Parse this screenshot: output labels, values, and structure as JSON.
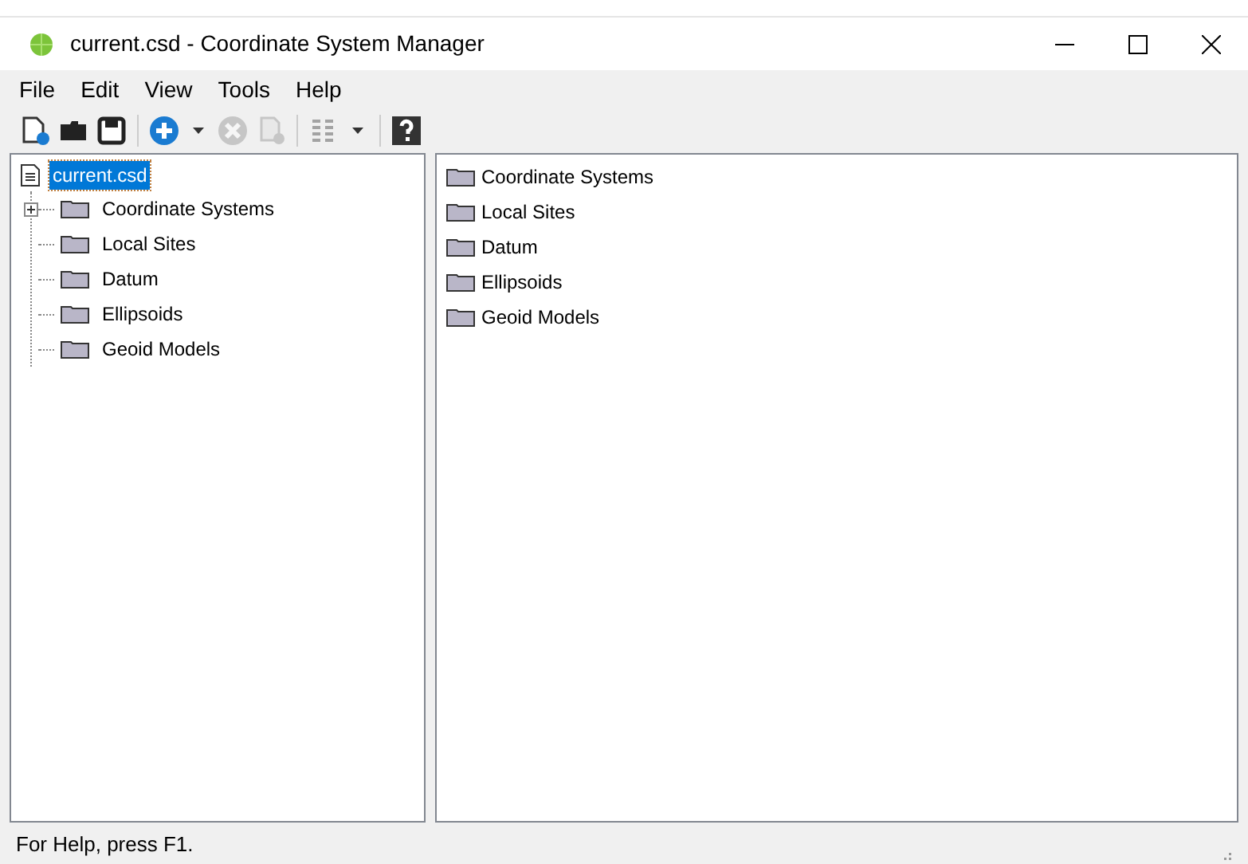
{
  "window": {
    "title": "current.csd - Coordinate System Manager"
  },
  "menu": [
    "File",
    "Edit",
    "View",
    "Tools",
    "Help"
  ],
  "toolbar": [
    {
      "kind": "new",
      "disabled": false
    },
    {
      "kind": "open",
      "disabled": false
    },
    {
      "kind": "save",
      "disabled": false
    },
    {
      "kind": "separator"
    },
    {
      "kind": "add",
      "disabled": false
    },
    {
      "kind": "dropdown",
      "disabled": false
    },
    {
      "kind": "delete",
      "disabled": true
    },
    {
      "kind": "copy",
      "disabled": true
    },
    {
      "kind": "separator"
    },
    {
      "kind": "columns",
      "disabled": true
    },
    {
      "kind": "dropdown",
      "disabled": false
    },
    {
      "kind": "separator"
    },
    {
      "kind": "help",
      "disabled": false
    }
  ],
  "tree": {
    "label": "current.csd",
    "selected": true,
    "children": [
      {
        "label": "Coordinate Systems",
        "expandable": true,
        "selected": false
      },
      {
        "label": "Local Sites",
        "expandable": false,
        "selected": false
      },
      {
        "label": "Datum",
        "expandable": false,
        "selected": false
      },
      {
        "label": "Ellipsoids",
        "expandable": false,
        "selected": false
      },
      {
        "label": "Geoid Models",
        "expandable": false,
        "selected": false
      }
    ]
  },
  "list": [
    "Coordinate Systems",
    "Local Sites",
    "Datum",
    "Ellipsoids",
    "Geoid Models"
  ],
  "status_bar": "For Help, press F1."
}
